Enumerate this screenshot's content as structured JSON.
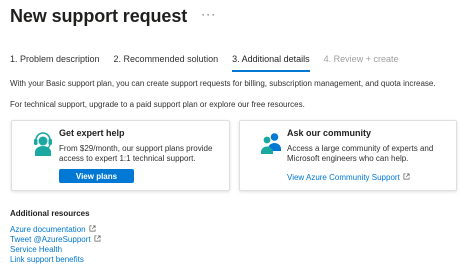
{
  "header": {
    "title": "New support request",
    "more_label": "···"
  },
  "tabs": [
    {
      "label": "1. Problem description",
      "state": "default"
    },
    {
      "label": "2. Recommended solution",
      "state": "default"
    },
    {
      "label": "3. Additional details",
      "state": "active"
    },
    {
      "label": "4. Review + create",
      "state": "disabled"
    }
  ],
  "intro": {
    "line1": "With your Basic support plan, you can create support requests for billing, subscription management, and quota increase.",
    "line2": "For technical support, upgrade to a paid support plan or explore our free resources."
  },
  "cards": {
    "expert": {
      "icon": "support-agent-icon",
      "title": "Get expert help",
      "text_line1": "From $29/month, our support plans provide",
      "text_line2": "access to expert 1:1 technical support.",
      "button_label": "View plans"
    },
    "community": {
      "icon": "community-people-icon",
      "title": "Ask our community",
      "text_line1": "Access a large community of experts and",
      "text_line2": "Microsoft engineers who can help.",
      "link_label": "View Azure Community Support"
    }
  },
  "resources": {
    "heading": "Additional resources",
    "links": [
      {
        "label": "Azure documentation",
        "external": true
      },
      {
        "label": "Tweet @AzureSupport",
        "external": true
      },
      {
        "label": "Service Health",
        "external": false
      },
      {
        "label": "Link support benefits",
        "external": false
      }
    ]
  },
  "colors": {
    "accent": "#0078d4",
    "icon_teal": "#1ba8a0",
    "text": "#323130",
    "disabled": "#a19f9d"
  }
}
